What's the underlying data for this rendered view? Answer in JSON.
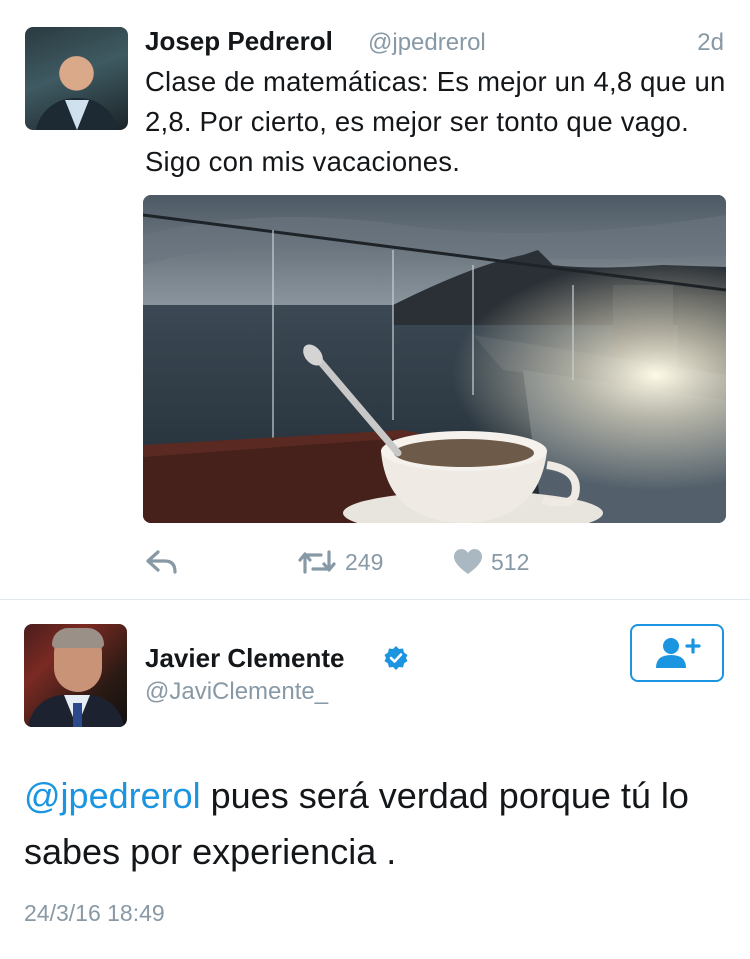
{
  "tweet1": {
    "author_name": "Josep Pedrerol",
    "author_handle": "@jpedrerol",
    "timestamp": "2d",
    "text": "Clase de matemáticas: Es mejor un 4,8 que un 2,8. Por cierto, es mejor ser tonto que vago. Sigo con mis vacaciones.",
    "actions": {
      "reply_icon": "reply-icon",
      "retweet_icon": "retweet-icon",
      "retweet_count": "249",
      "like_icon": "heart-icon",
      "like_count": "512"
    }
  },
  "tweet2": {
    "author_name": "Javier Clemente",
    "author_handle": "@JaviClemente_",
    "verified_icon": "verified-badge-icon",
    "follow_icon": "add-user-icon",
    "mention": "@jpedrerol",
    "text": " pues será verdad porque tú lo sabes por experiencia .",
    "date": "24/3/16 18:49"
  },
  "colors": {
    "accent": "#1b95e0",
    "muted": "#8899a6",
    "text": "#14171a",
    "divider": "#e1e8ed"
  }
}
